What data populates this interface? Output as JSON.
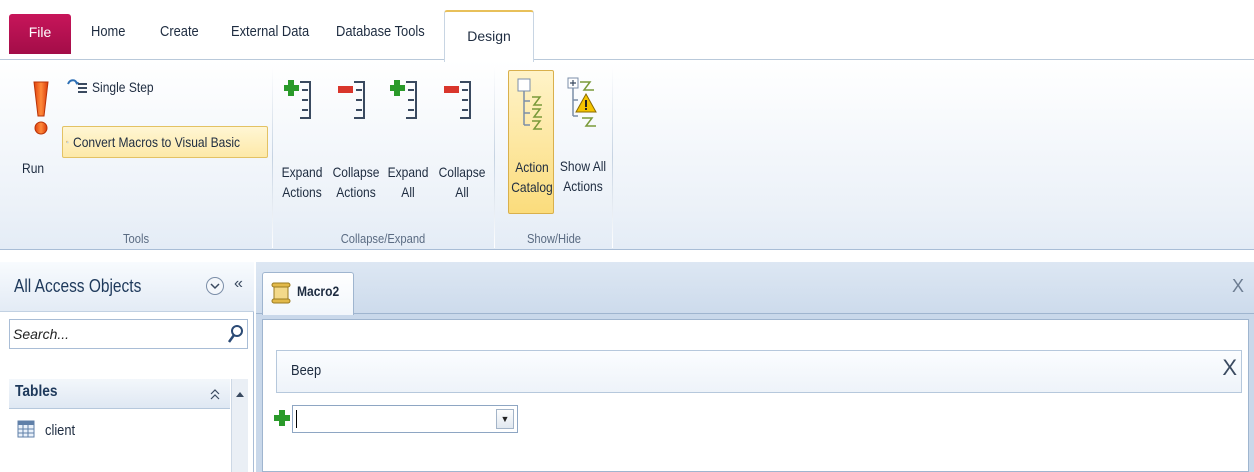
{
  "tabs": {
    "file": "File",
    "home": "Home",
    "create": "Create",
    "external_data": "External Data",
    "database_tools": "Database Tools",
    "design": "Design"
  },
  "ribbon": {
    "tools": {
      "run": "Run",
      "single_step": "Single Step",
      "convert": "Convert Macros to Visual Basic",
      "group_label": "Tools"
    },
    "collapse_expand": {
      "expand_actions": [
        "Expand",
        "Actions"
      ],
      "collapse_actions": [
        "Collapse",
        "Actions"
      ],
      "expand_all": [
        "Expand",
        "All"
      ],
      "collapse_all": [
        "Collapse",
        "All"
      ],
      "group_label": "Collapse/Expand"
    },
    "show_hide": {
      "action_catalog": [
        "Action",
        "Catalog"
      ],
      "show_all_actions": [
        "Show All",
        "Actions"
      ],
      "group_label": "Show/Hide"
    }
  },
  "nav": {
    "title": "All Access Objects",
    "collapse_glyph": "«",
    "search_placeholder": "Search...",
    "group": "Tables",
    "items": [
      "client"
    ]
  },
  "document": {
    "tab_label": "Macro2",
    "close": "X",
    "action_name": "Beep",
    "action_delete": "X",
    "add_new_action_value": ""
  },
  "colors": {
    "file_tab": "#b8114f",
    "accent_highlight": "#fbdc7c",
    "ribbon_text": "#1e2c40"
  }
}
